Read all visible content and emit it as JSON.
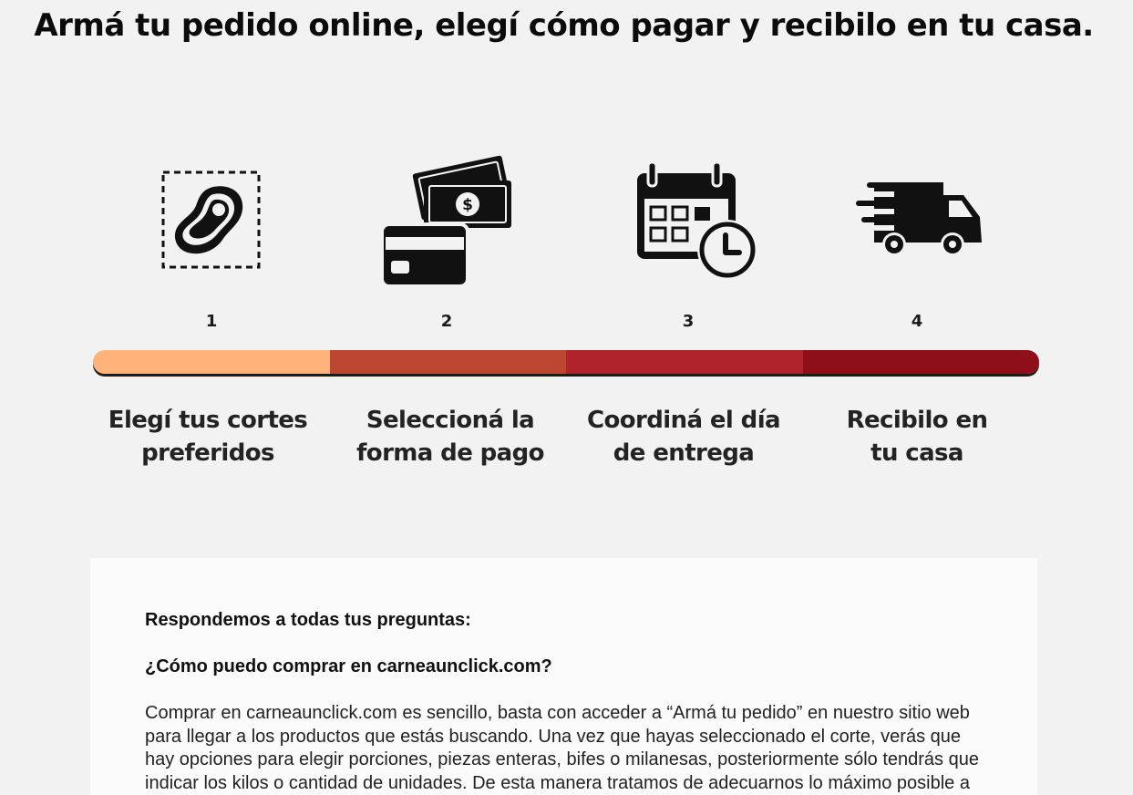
{
  "page": {
    "title": "Armá tu pedido online, elegí cómo pagar y recibilo en tu casa."
  },
  "steps": [
    {
      "number": "1",
      "label": "Elegí tus cortes\npreferidos",
      "icon": "steak-icon",
      "color": "#ffb27a"
    },
    {
      "number": "2",
      "label": "Seleccioná la\nforma de pago",
      "icon": "payment-icon",
      "color": "#bb4732"
    },
    {
      "number": "3",
      "label": "Coordiná el día\nde entrega",
      "icon": "calendar-clock-icon",
      "color": "#b0222c"
    },
    {
      "number": "4",
      "label": "Recibilo en\ntu casa",
      "icon": "delivery-truck-icon",
      "color": "#8e0f19"
    }
  ],
  "faq": {
    "heading": "Respondemos a todas tus preguntas:",
    "question": "¿Cómo puedo comprar en carneaunclick.com?",
    "answer": "Comprar en carneaunclick.com es sencillo, basta con acceder a “Armá tu pedido” en nuestro sitio web para llegar a los productos que estás buscando. Una vez que hayas seleccionado el corte, verás que hay opciones para elegir porciones, piezas enteras, bifes o milanesas, posteriormente sólo tendrás que indicar los kilos o cantidad de unidades. De esta manera tratamos de adecuarnos lo máximo posible a"
  }
}
